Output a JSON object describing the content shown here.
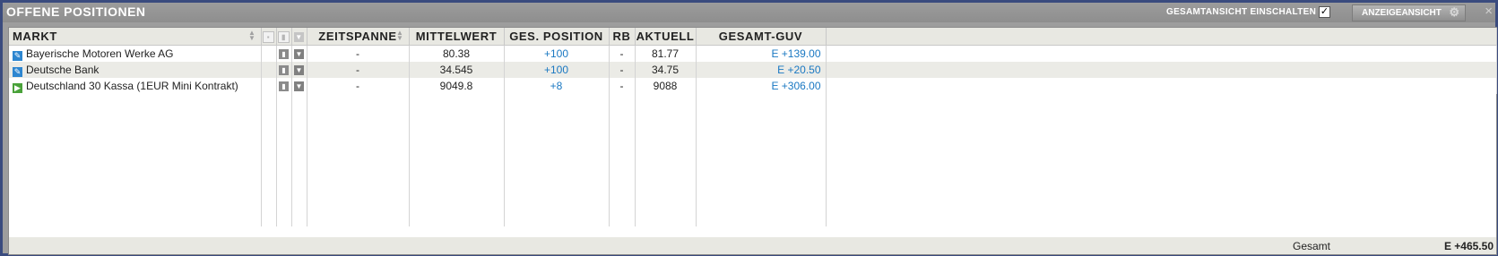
{
  "window": {
    "title": "OFFENE POSITIONEN",
    "close_icon": "×"
  },
  "toolbar": {
    "toggle_label": "GESAMTANSICHT EINSCHALTEN",
    "toggle_checked": "✓",
    "view_button_label": "ANZEIGEANSICHT"
  },
  "columns": {
    "market": "MARKT",
    "period": "ZEITSPANNE",
    "mean": "MITTELWERT",
    "position": "GES. POSITION",
    "rb": "RB",
    "current": "AKTUELL",
    "pnl": "GESAMT-GUV"
  },
  "rows": [
    {
      "icon": "edit-icon",
      "market": "Bayerische Motoren Werke AG",
      "period": "-",
      "mean": "80.38",
      "position": "+100",
      "rb": "-",
      "current": "81.77",
      "pnl": "E +139.00"
    },
    {
      "icon": "edit-icon",
      "market": "Deutsche Bank",
      "period": "-",
      "mean": "34.545",
      "position": "+100",
      "rb": "-",
      "current": "34.75",
      "pnl": "E +20.50"
    },
    {
      "icon": "play-icon",
      "market": "Deutschland 30 Kassa (1EUR Mini Kontrakt)",
      "period": "-",
      "mean": "9049.8",
      "position": "+8",
      "rb": "-",
      "current": "9088",
      "pnl": "E +306.00"
    }
  ],
  "footer": {
    "label": "Gesamt",
    "total": "E +465.50"
  },
  "colors": {
    "accent_blue": "#1a78c2",
    "title_bar": "#959595",
    "border": "#3a4b7e"
  }
}
